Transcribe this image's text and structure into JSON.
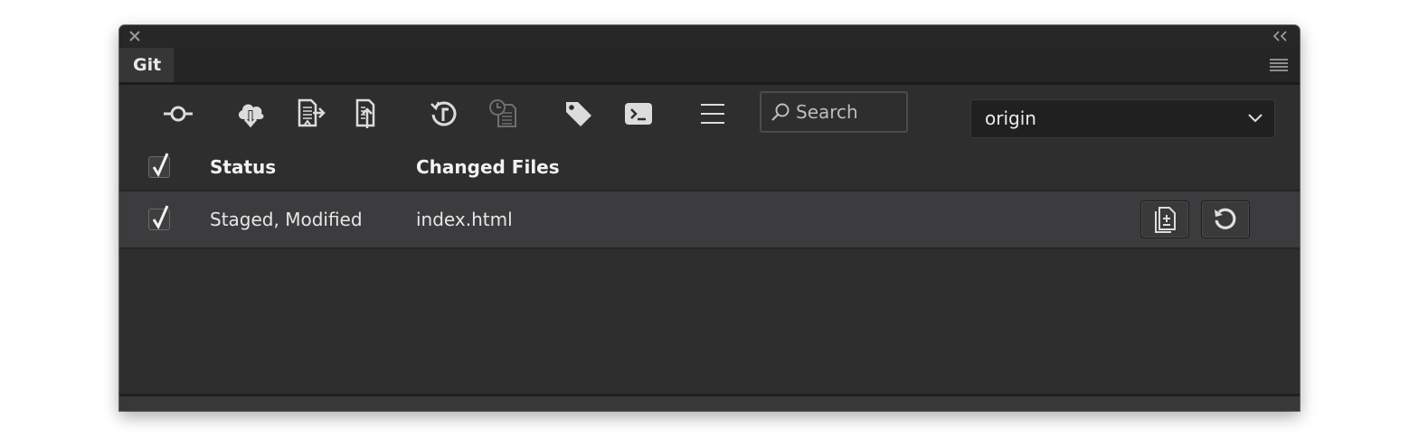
{
  "panel": {
    "tab_label": "Git"
  },
  "toolbar": {
    "buttons": [
      {
        "name": "commit-icon"
      },
      {
        "name": "cloud-download-icon"
      },
      {
        "name": "push-file-icon"
      },
      {
        "name": "pull-file-icon"
      },
      {
        "name": "history-icon"
      },
      {
        "name": "file-history-icon",
        "disabled": true
      },
      {
        "name": "tag-icon"
      },
      {
        "name": "terminal-icon"
      },
      {
        "name": "menu-icon"
      }
    ],
    "search_placeholder": "Search",
    "remote_selected": "origin"
  },
  "table": {
    "headers": {
      "status": "Status",
      "changed_files": "Changed Files"
    },
    "select_all_checked": true,
    "rows": [
      {
        "checked": true,
        "status": "Staged, Modified",
        "file": "index.html"
      }
    ]
  },
  "colors": {
    "panel_bg": "#2e2e2e",
    "row_bg": "#3c3c3e",
    "text": "#e6e6e6",
    "disabled_icon": "#6f6f6f"
  }
}
